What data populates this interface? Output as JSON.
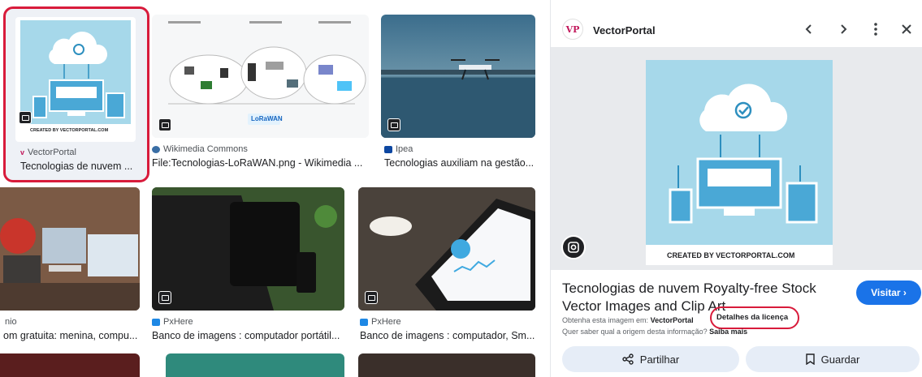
{
  "results": [
    {
      "source": "VectorPortal",
      "title": "Tecnologias de nuvem ...",
      "selected": true
    },
    {
      "source": "Wikimedia Commons",
      "title": "File:Tecnologias-LoRaWAN.png - Wikimedia ..."
    },
    {
      "source": "Ipea",
      "title": "Tecnologias auxiliam na gestão..."
    },
    {
      "source": "nio",
      "title": "om gratuita: menina, compu..."
    },
    {
      "source": "PxHere",
      "title": "Banco de imagens : computador portátil..."
    },
    {
      "source": "PxHere",
      "title": "Banco de imagens : computador, Sm..."
    }
  ],
  "thumb_text": {
    "vp_credit": "CREATED BY VECTORPORTAL.COM",
    "lorawan_logo": "LoRaWAN"
  },
  "preview": {
    "site_name": "VectorPortal",
    "logo_text": "VP",
    "image_credit": "CREATED BY VECTORPORTAL.COM",
    "title": "Tecnologias de nuvem Royalty-free Stock Vector Images and Clip Art",
    "visit_label": "Visitar ›",
    "source_prefix": "Obtenha esta imagem em:",
    "source_name": "VectorPortal",
    "license_label": "Detalhes da licença",
    "origin_question": "Quer saber qual a origem desta informação?",
    "learn_more": "Saiba mais",
    "share_label": "Partilhar",
    "save_label": "Guardar"
  },
  "icons": {
    "prev": "chevron-left-icon",
    "next": "chevron-right-icon",
    "more": "more-vert-icon",
    "close": "close-icon",
    "lens": "google-lens-icon",
    "share": "share-icon",
    "save": "bookmark-icon",
    "image_badge": "image-icon"
  },
  "colors": {
    "highlight": "#d81b3b",
    "visit_button": "#1a73e8",
    "action_button_bg": "#e6edf7",
    "illustration_bg": "#a6d8ea",
    "illustration_line": "#2d8fbf"
  }
}
